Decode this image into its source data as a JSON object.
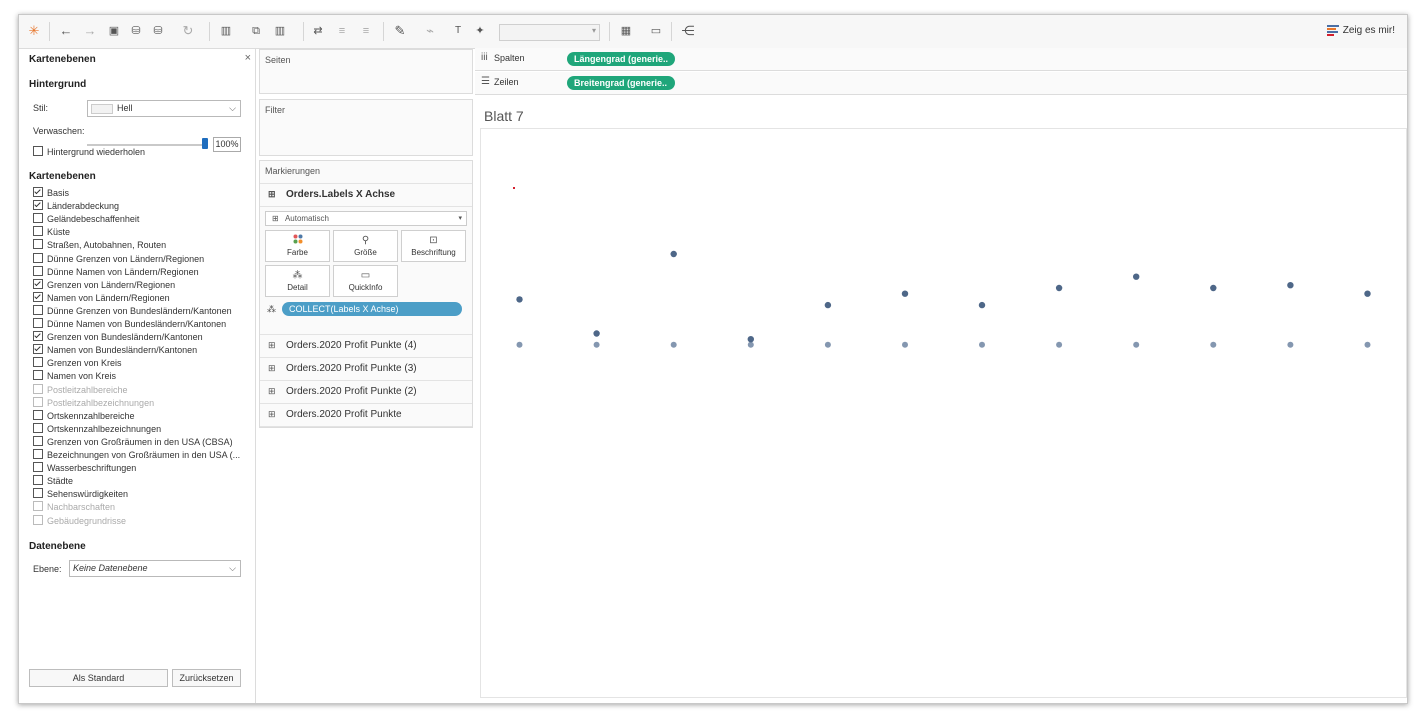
{
  "toolbar": {
    "show_me_label": "Zeig es mir!",
    "icons": [
      "tableau-logo-icon",
      "undo-icon",
      "redo-icon",
      "save-icon",
      "new-datasource-icon",
      "pause-icon",
      "refresh-icon",
      "new-sheet-icon",
      "duplicate-icon",
      "clear-icon",
      "swap-icon",
      "sort-asc-icon",
      "sort-desc-icon",
      "highlight-icon",
      "group-icon",
      "label-icon",
      "pin-icon",
      "fit-icon",
      "presentation-icon",
      "share-icon"
    ]
  },
  "left_panel": {
    "title": "Kartenebenen",
    "close_label": "×",
    "background": {
      "heading": "Hintergrund",
      "style_label": "Stil:",
      "style_value": "Hell",
      "wash_label": "Verwaschen:",
      "wash_percent": "100%",
      "wash_value": 100,
      "repeat_label": "Hintergrund wiederholen",
      "repeat_checked": false
    },
    "layers": {
      "heading": "Kartenebenen",
      "items": [
        {
          "label": "Basis",
          "checked": true,
          "disabled": false
        },
        {
          "label": "Länderabdeckung",
          "checked": true,
          "disabled": false
        },
        {
          "label": "Geländebeschaffenheit",
          "checked": false,
          "disabled": false
        },
        {
          "label": "Küste",
          "checked": false,
          "disabled": false
        },
        {
          "label": "Straßen, Autobahnen, Routen",
          "checked": false,
          "disabled": false
        },
        {
          "label": "Dünne Grenzen von Ländern/Regionen",
          "checked": false,
          "disabled": false
        },
        {
          "label": "Dünne Namen von Ländern/Regionen",
          "checked": false,
          "disabled": false
        },
        {
          "label": "Grenzen von Ländern/Regionen",
          "checked": true,
          "disabled": false
        },
        {
          "label": "Namen von Ländern/Regionen",
          "checked": true,
          "disabled": false
        },
        {
          "label": "Dünne Grenzen von Bundesländern/Kantonen",
          "checked": false,
          "disabled": false
        },
        {
          "label": "Dünne Namen von Bundesländern/Kantonen",
          "checked": false,
          "disabled": false
        },
        {
          "label": "Grenzen von Bundesländern/Kantonen",
          "checked": true,
          "disabled": false
        },
        {
          "label": "Namen von Bundesländern/Kantonen",
          "checked": true,
          "disabled": false
        },
        {
          "label": "Grenzen von Kreis",
          "checked": false,
          "disabled": false
        },
        {
          "label": "Namen von Kreis",
          "checked": false,
          "disabled": false
        },
        {
          "label": "Postleitzahlbereiche",
          "checked": false,
          "disabled": true
        },
        {
          "label": "Postleitzahlbezeichnungen",
          "checked": false,
          "disabled": true
        },
        {
          "label": "Ortskennzahlbereiche",
          "checked": false,
          "disabled": false
        },
        {
          "label": "Ortskennzahlbezeichnungen",
          "checked": false,
          "disabled": false
        },
        {
          "label": "Grenzen von Großräumen in den USA (CBSA)",
          "checked": false,
          "disabled": false
        },
        {
          "label": "Bezeichnungen von Großräumen in den USA (...",
          "checked": false,
          "disabled": false
        },
        {
          "label": "Wasserbeschriftungen",
          "checked": false,
          "disabled": false
        },
        {
          "label": "Städte",
          "checked": false,
          "disabled": false
        },
        {
          "label": "Sehenswürdigkeiten",
          "checked": false,
          "disabled": false
        },
        {
          "label": "Nachbarschaften",
          "checked": false,
          "disabled": true
        },
        {
          "label": "Gebäudegrundrisse",
          "checked": false,
          "disabled": true
        }
      ]
    },
    "data_layer": {
      "heading": "Datenebene",
      "layer_label": "Ebene:",
      "layer_value": "Keine Datenebene"
    },
    "buttons": {
      "default_label": "Als Standard",
      "reset_label": "Zurücksetzen"
    }
  },
  "cards": {
    "pages_title": "Seiten",
    "filter_title": "Filter",
    "marks_title": "Markierungen",
    "active_layer": "Orders.Labels X Achse",
    "mark_type": "Automatisch",
    "buttons": {
      "color": "Farbe",
      "size": "Größe",
      "label": "Beschriftung",
      "detail": "Detail",
      "tooltip": "QuickInfo"
    },
    "field_pill": "COLLECT(Labels X Achse)",
    "other_layers": [
      "Orders.2020 Profit Punkte (4)",
      "Orders.2020 Profit Punkte (3)",
      "Orders.2020 Profit Punkte (2)",
      "Orders.2020 Profit Punkte"
    ]
  },
  "shelves": {
    "columns_label": "Spalten",
    "columns_pill": "Längengrad (generie..",
    "rows_label": "Zeilen",
    "rows_pill": "Breitengrad (generie.."
  },
  "sheet": {
    "title": "Blatt 7"
  },
  "chart_data": {
    "type": "scatter",
    "x": [
      1,
      2,
      3,
      4,
      5,
      6,
      7,
      8,
      9,
      10,
      11,
      12
    ],
    "series": [
      {
        "values": [
          0.62,
          0.62,
          0.62,
          0.62,
          0.62,
          0.62,
          0.62,
          0.62,
          0.62,
          0.62,
          0.62,
          0.62
        ],
        "color": "#8497b0"
      },
      {
        "values": [
          0.7,
          0.64,
          0.78,
          0.63,
          0.69,
          0.71,
          0.69,
          0.72,
          0.74,
          0.72,
          0.725,
          0.71
        ],
        "color": "#4e6788"
      }
    ],
    "marker_color": "#d3202f",
    "grid": false,
    "xlim": [
      0.5,
      12.5
    ],
    "ylim": [
      0,
      1
    ]
  }
}
